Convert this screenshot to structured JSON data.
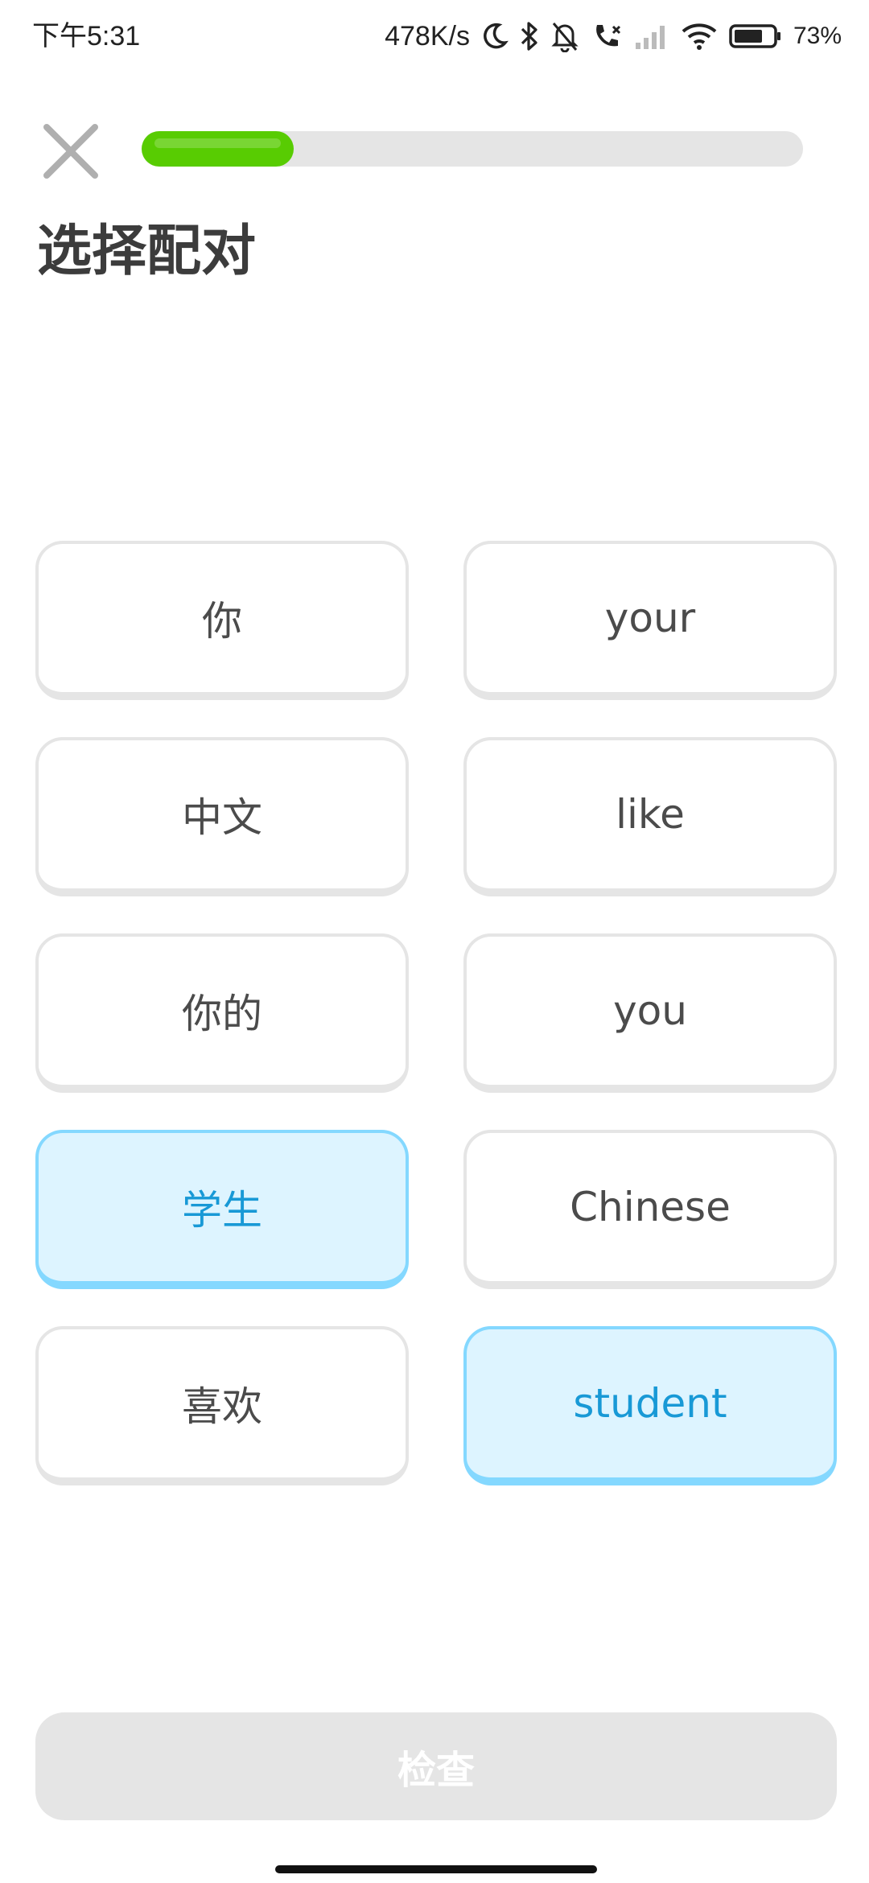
{
  "status_bar": {
    "time": "下午5:31",
    "net_speed": "478K/s",
    "battery": "73%",
    "icons": [
      "moon-icon",
      "bluetooth-icon",
      "bell-off-icon",
      "call-forward-icon",
      "signal-icon",
      "wifi-icon",
      "battery-icon"
    ]
  },
  "progress": {
    "fraction": 0.23
  },
  "header": {
    "title": "选择配对"
  },
  "pairs": {
    "left": [
      {
        "text": "你",
        "selected": false
      },
      {
        "text": "中文",
        "selected": false
      },
      {
        "text": "你的",
        "selected": false
      },
      {
        "text": "学生",
        "selected": true
      },
      {
        "text": "喜欢",
        "selected": false
      }
    ],
    "right": [
      {
        "text": "your",
        "selected": false
      },
      {
        "text": "like",
        "selected": false
      },
      {
        "text": "you",
        "selected": false
      },
      {
        "text": "Chinese",
        "selected": false
      },
      {
        "text": "student",
        "selected": true
      }
    ]
  },
  "footer": {
    "check_label": "检查",
    "check_enabled": false
  },
  "colors": {
    "progress": "#58cc02",
    "selected_bg": "#ddf4ff",
    "selected_border": "#84d8ff",
    "selected_text": "#1899d6",
    "disabled_button": "#e5e5e5"
  }
}
